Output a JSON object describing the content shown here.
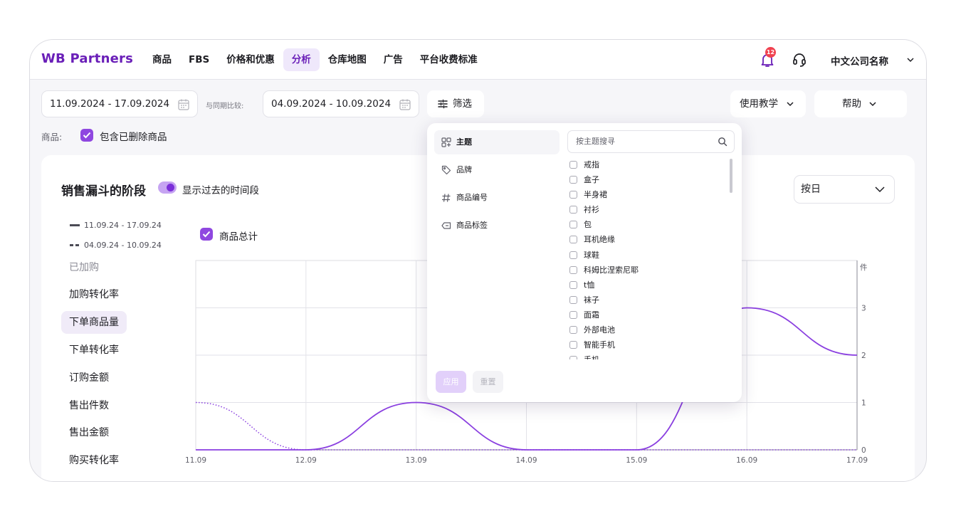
{
  "brand": "WB Partners",
  "nav": [
    "商品",
    "FBS",
    "价格和优惠",
    "分析",
    "仓库地图",
    "广告",
    "平台收费标准"
  ],
  "nav_active_index": 3,
  "notifications": {
    "count": "12",
    "icon": "bell-icon"
  },
  "support_icon": "headset-icon",
  "company": "中文公司名称",
  "toolbar": {
    "period": "11.09.2024 - 17.09.2024",
    "compare_label": "与同期比较:",
    "compare_period": "04.09.2024 - 10.09.2024",
    "filter": "筛选",
    "tutorial": "使用教学",
    "help": "帮助"
  },
  "goods": {
    "label": "商品:",
    "include_deleted": "包含已删除商品",
    "include_deleted_checked": true
  },
  "card": {
    "title": "销售漏斗的阶段",
    "show_past_label": "显示过去的时间段",
    "show_past_on": true,
    "legend": [
      {
        "label": "11.09.24 - 17.09.24",
        "style": "solid"
      },
      {
        "label": "04.09.24 - 10.09.24",
        "style": "dashed"
      }
    ],
    "metrics": [
      "已加购",
      "加购转化率",
      "下单商品量",
      "下单转化率",
      "订购金额",
      "售出件数",
      "售出金额",
      "购买转化率"
    ],
    "metric_active_index": 2,
    "metric_muted_index": 0,
    "total_checkbox": "商品总计",
    "period_select": "按日"
  },
  "chart_data": {
    "type": "line",
    "x": [
      "11.09",
      "12.09",
      "13.09",
      "14.09",
      "15.09",
      "16.09",
      "17.09"
    ],
    "y_unit": "件",
    "y_ticks": [
      0,
      1,
      2,
      3
    ],
    "ylim": [
      0,
      4
    ],
    "series": [
      {
        "values": [
          0,
          0,
          1,
          0,
          0,
          3,
          2
        ],
        "style": "solid",
        "color": "#8a3fe0"
      },
      {
        "values": [
          1,
          0,
          0,
          0,
          0,
          0,
          0
        ],
        "style": "dotted",
        "color": "#8a3fe0"
      }
    ],
    "grid": true
  },
  "filter_popover": {
    "sidebar": [
      {
        "label": "主题",
        "icon": "grid-icon",
        "active": true
      },
      {
        "label": "品牌",
        "icon": "tag-icon",
        "active": false
      },
      {
        "label": "商品编号",
        "icon": "hash-icon",
        "active": false
      },
      {
        "label": "商品标签",
        "icon": "label-icon",
        "active": false
      }
    ],
    "search_placeholder": "按主题搜寻",
    "items": [
      "戒指",
      "盒子",
      "半身裙",
      "衬衫",
      "包",
      "耳机绝缘",
      "球鞋",
      "科姆比涅索尼耶",
      "t恤",
      "袜子",
      "面霜",
      "外部电池",
      "智能手机",
      "手机"
    ],
    "apply": "应用",
    "reset": "重置"
  },
  "colors": {
    "accent": "#6a1fb8",
    "line": "#8a3fe0",
    "badge": "#f0414f"
  }
}
